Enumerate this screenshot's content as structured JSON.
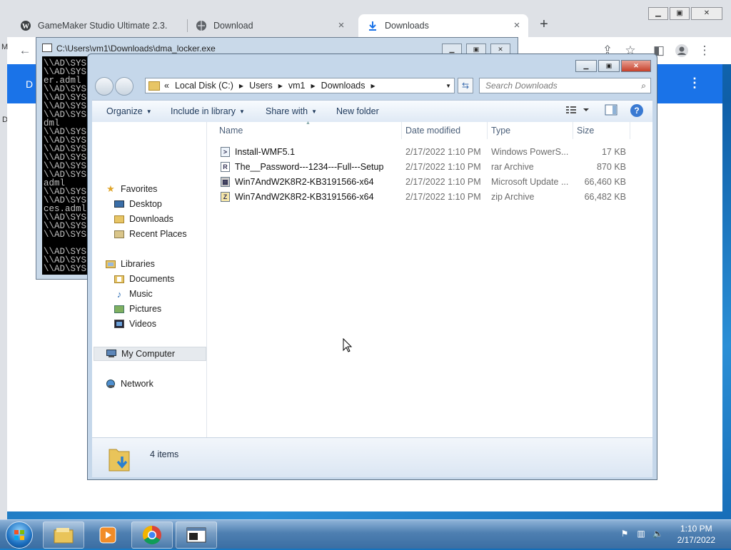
{
  "browser": {
    "tabs": [
      {
        "title": "GameMaker Studio Ultimate 2.3.",
        "icon": "wordpress-icon"
      },
      {
        "title": "Download",
        "icon": "globe-icon"
      },
      {
        "title": "Downloads",
        "icon": "download-icon"
      }
    ],
    "page_initial": "D",
    "left_letters": [
      "M",
      "D"
    ]
  },
  "console": {
    "title": "C:\\Users\\vm1\\Downloads\\dma_locker.exe",
    "lines": [
      "\\\\AD\\SYS",
      "\\\\AD\\SYS",
      "er.adml",
      "\\\\AD\\SYS",
      "\\\\AD\\SYS",
      "\\\\AD\\SYS",
      "\\\\AD\\SYS",
      "dml",
      "\\\\AD\\SYS",
      "\\\\AD\\SYS",
      "\\\\AD\\SYS",
      "\\\\AD\\SYS",
      "\\\\AD\\SYS",
      "\\\\AD\\SYS",
      "adml",
      "\\\\AD\\SYS",
      "\\\\AD\\SYS",
      "ces.adml",
      "\\\\AD\\SYS",
      "\\\\AD\\SYS",
      "\\\\AD\\SYS",
      "",
      "\\\\AD\\SYS",
      "\\\\AD\\SYS",
      "\\\\AD\\SYS"
    ]
  },
  "explorer": {
    "address": {
      "prefix": "«",
      "crumbs": [
        "Local Disk (C:)",
        "Users",
        "vm1",
        "Downloads"
      ]
    },
    "search_placeholder": "Search Downloads",
    "commands": {
      "organize": "Organize",
      "include": "Include in library",
      "share": "Share with",
      "newfolder": "New folder"
    },
    "nav": {
      "favorites": "Favorites",
      "desktop": "Desktop",
      "downloads": "Downloads",
      "recent": "Recent Places",
      "libraries": "Libraries",
      "documents": "Documents",
      "music": "Music",
      "pictures": "Pictures",
      "videos": "Videos",
      "computer": "My Computer",
      "network": "Network"
    },
    "columns": {
      "name": "Name",
      "date": "Date modified",
      "type": "Type",
      "size": "Size"
    },
    "files": [
      {
        "name": "Install-WMF5.1",
        "date": "2/17/2022 1:10 PM",
        "type": "Windows PowerS...",
        "size": "17 KB",
        "icon": "powershell-file-icon"
      },
      {
        "name": "The__Password---1234---Full---Setup",
        "date": "2/17/2022 1:10 PM",
        "type": "rar Archive",
        "size": "870 KB",
        "icon": "rar-archive-icon"
      },
      {
        "name": "Win7AndW2K8R2-KB3191566-x64",
        "date": "2/17/2022 1:10 PM",
        "type": "Microsoft Update ...",
        "size": "66,460 KB",
        "icon": "update-package-icon"
      },
      {
        "name": "Win7AndW2K8R2-KB3191566-x64",
        "date": "2/17/2022 1:10 PM",
        "type": "zip Archive",
        "size": "66,482 KB",
        "icon": "zip-archive-icon"
      }
    ],
    "status": "4 items"
  },
  "taskbar": {
    "time": "1:10 PM",
    "date": "2/17/2022"
  },
  "colors": {
    "chrome_blue": "#1a73e8",
    "explorer_frame": "#c5d7ea",
    "taskbar": "#4e7fb1"
  }
}
